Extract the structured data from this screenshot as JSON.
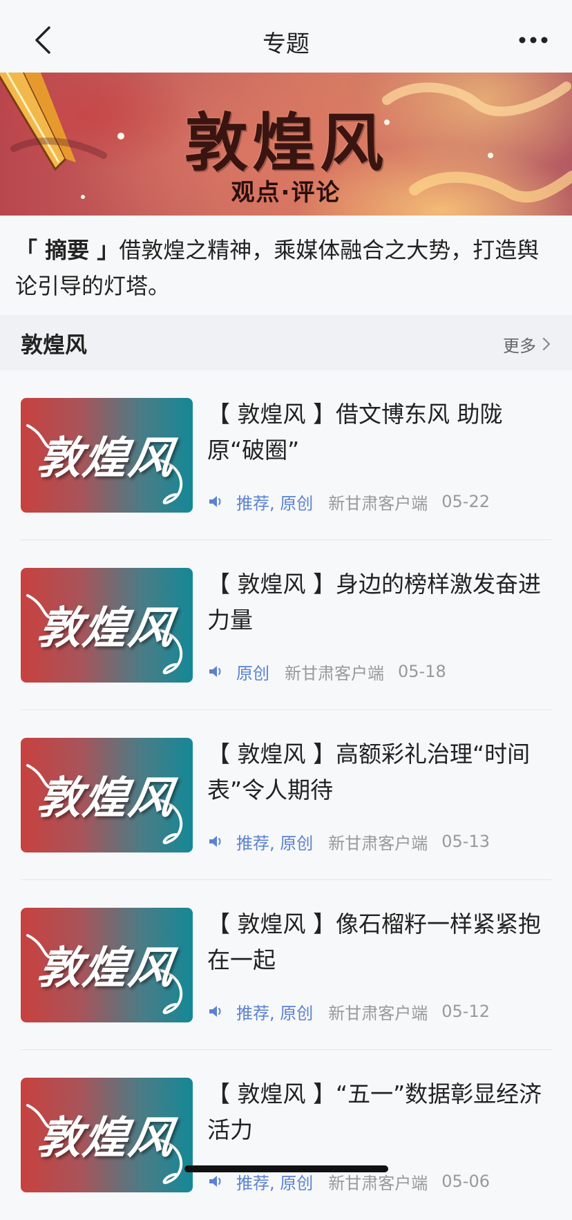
{
  "nav": {
    "title": "专题"
  },
  "banner": {
    "title": "敦煌风",
    "subtitle": "观点·评论"
  },
  "summary": {
    "tag": "「 摘要 」",
    "text": "借敦煌之精神，乘媒体融合之大势，打造舆论引导的灯塔。"
  },
  "section": {
    "title": "敦煌风",
    "more_label": "更多"
  },
  "thumbnail_text": "敦煌风",
  "items": [
    {
      "title": "【 敦煌风 】借文博东风  助陇原“破圈”",
      "tags": "推荐, 原创",
      "source": "新甘肃客户端",
      "date": "05-22"
    },
    {
      "title": "【 敦煌风 】身边的榜样激发奋进力量",
      "tags": "原创",
      "source": "新甘肃客户端",
      "date": "05-18"
    },
    {
      "title": "【 敦煌风 】高额彩礼治理“时间表”令人期待",
      "tags": "推荐, 原创",
      "source": "新甘肃客户端",
      "date": "05-13"
    },
    {
      "title": "【 敦煌风 】像石榴籽一样紧紧抱在一起",
      "tags": "推荐, 原创",
      "source": "新甘肃客户端",
      "date": "05-12"
    },
    {
      "title": "【 敦煌风 】“五一”数据彰显经济活力",
      "tags": "推荐, 原创",
      "source": "新甘肃客户端",
      "date": "05-06"
    }
  ],
  "colors": {
    "accent": "#5b82d1",
    "meta_gray": "#999999",
    "background": "#f7f8fa",
    "section_bg": "#eff1f4"
  }
}
